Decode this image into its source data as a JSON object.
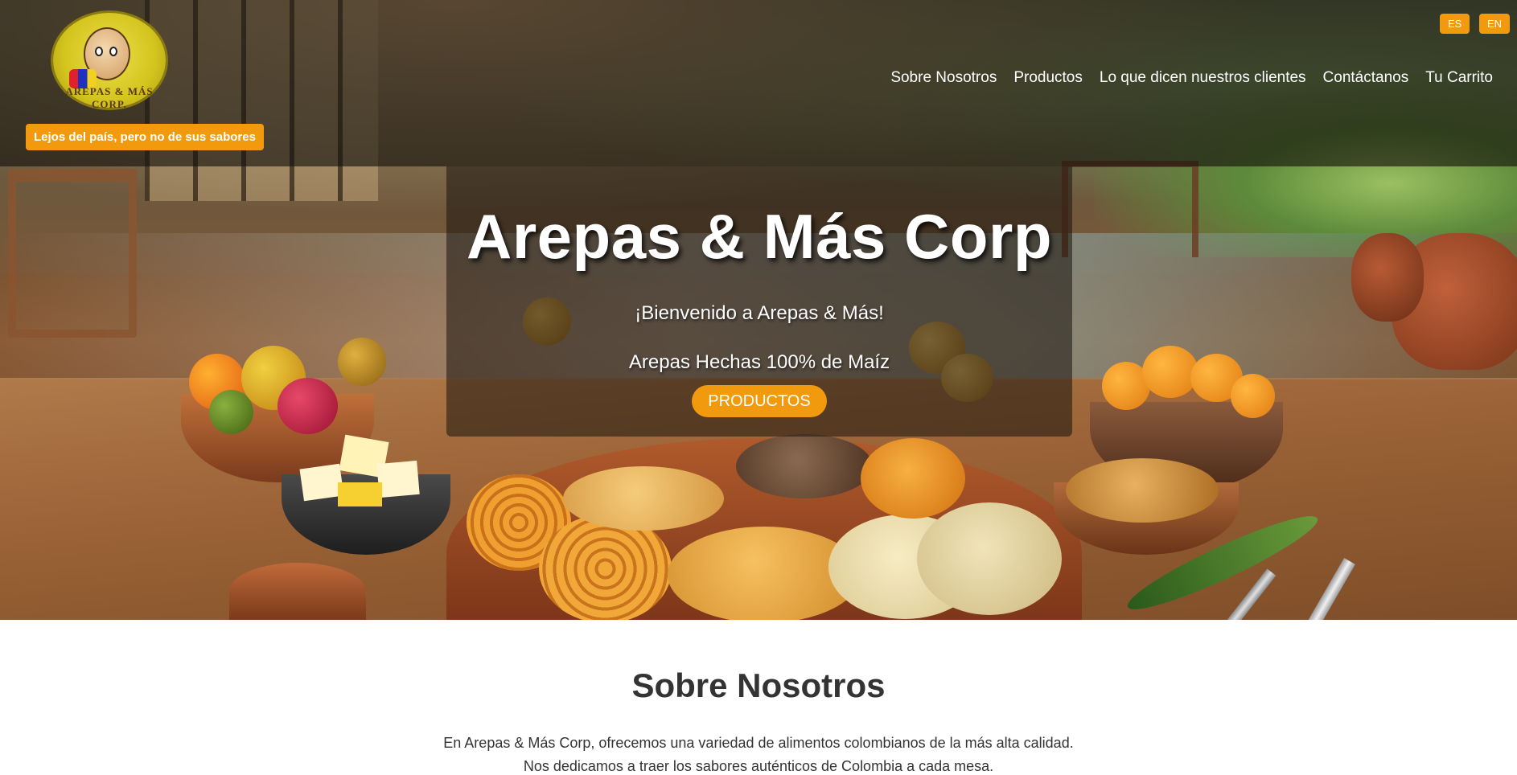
{
  "header": {
    "logo_alt": "AREPAS & MÁS CORP.",
    "tagline": "Lejos del país, pero no de sus sabores",
    "languages": [
      "ES",
      "EN"
    ],
    "nav": [
      "Sobre Nosotros",
      "Productos",
      "Lo que dicen nuestros clientes",
      "Contáctanos",
      "Tu Carrito"
    ]
  },
  "hero": {
    "title": "Arepas & Más Corp",
    "welcome": "¡Bienvenido a Arepas & Más!",
    "subtitle": "Arepas Hechas 100% de Maíz",
    "cta_label": "PRODUCTOS"
  },
  "about": {
    "heading": "Sobre Nosotros",
    "line1": "En Arepas & Más Corp, ofrecemos una variedad de alimentos colombianos de la más alta calidad.",
    "line2": "Nos dedicamos a traer los sabores auténticos de Colombia a cada mesa."
  },
  "colors": {
    "accent": "#f29a0d",
    "header_overlay": "rgba(20,16,12,0.62)",
    "text_dark": "#333333"
  }
}
